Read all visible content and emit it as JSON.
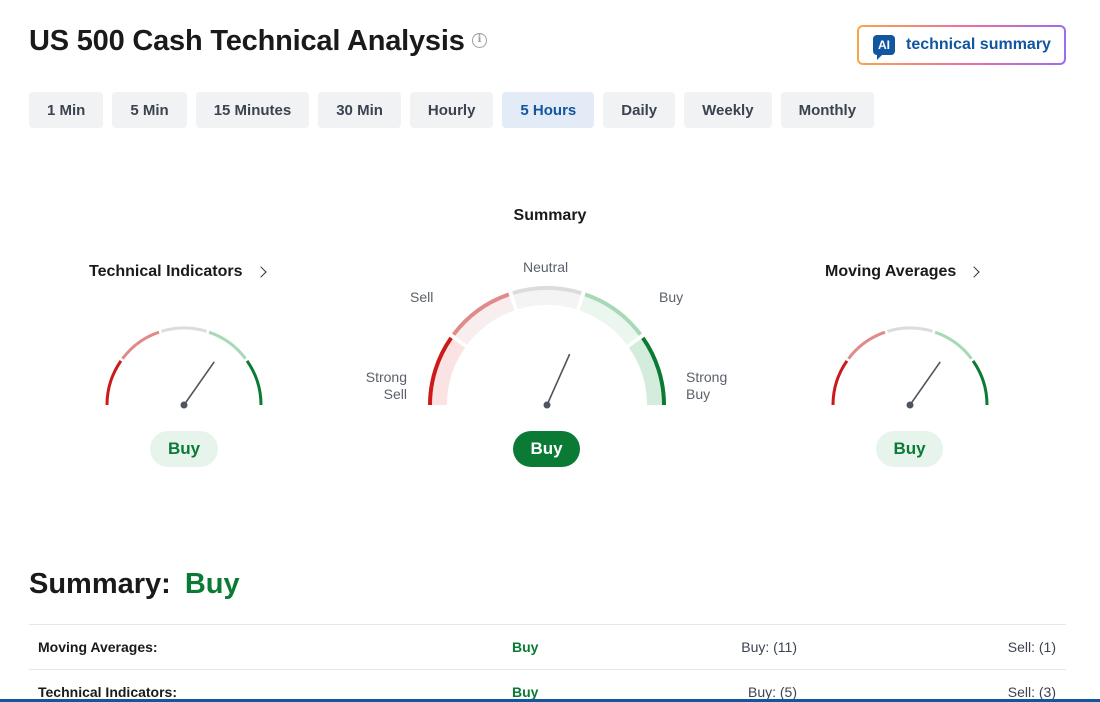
{
  "header": {
    "title": "US 500 Cash Technical Analysis",
    "ai_badge": "AI",
    "ai_button_label": "technical summary"
  },
  "tabs": [
    {
      "label": "1 Min",
      "active": false
    },
    {
      "label": "5 Min",
      "active": false
    },
    {
      "label": "15 Minutes",
      "active": false
    },
    {
      "label": "30 Min",
      "active": false
    },
    {
      "label": "Hourly",
      "active": false
    },
    {
      "label": "5 Hours",
      "active": true
    },
    {
      "label": "Daily",
      "active": false
    },
    {
      "label": "Weekly",
      "active": false
    },
    {
      "label": "Monthly",
      "active": false
    }
  ],
  "gauges": {
    "technical_indicators": {
      "title": "Technical Indicators",
      "signal": "Buy"
    },
    "summary": {
      "title": "Summary",
      "signal": "Buy",
      "labels": {
        "neutral": "Neutral",
        "sell": "Sell",
        "buy": "Buy",
        "strong_sell": "Strong\nSell",
        "strong_buy": "Strong\nBuy"
      }
    },
    "moving_averages": {
      "title": "Moving Averages",
      "signal": "Buy"
    }
  },
  "summary_section": {
    "label": "Summary:",
    "value": "Buy",
    "rows": [
      {
        "name": "Moving Averages:",
        "signal": "Buy",
        "buy": "Buy: (11)",
        "sell": "Sell: (1)"
      },
      {
        "name": "Technical Indicators:",
        "signal": "Buy",
        "buy": "Buy: (5)",
        "sell": "Sell: (3)"
      }
    ]
  },
  "colors": {
    "strong_sell": "#cc1a1a",
    "sell": "#e08a8a",
    "neutral": "#dcdcdc",
    "buy": "#a7d9b8",
    "strong_buy": "#0a7a35",
    "accent": "#1256a0"
  }
}
